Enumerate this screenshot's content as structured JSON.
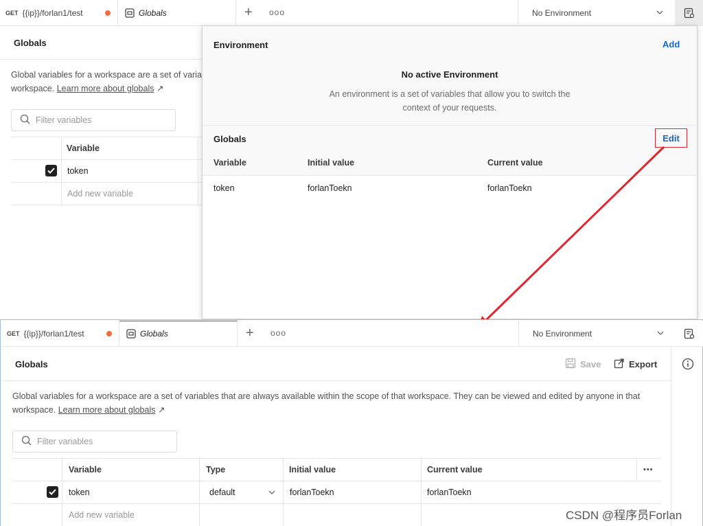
{
  "top": {
    "tab_request": {
      "method": "GET",
      "url": "{{ip}}/forlan1/test"
    },
    "tab_globals": "Globals",
    "environment_selector": "No Environment",
    "page_title": "Globals",
    "description_line1": "Global variables for a workspace are a set of varia",
    "description_line2_prefix": "workspace.",
    "learn_more": "Learn more about globals",
    "filter_placeholder": "Filter variables",
    "col_variable": "Variable",
    "row_variable": "token",
    "add_new": "Add new variable"
  },
  "popup": {
    "env_heading": "Environment",
    "add": "Add",
    "no_env_title": "No active Environment",
    "no_env_text_1": "An environment is a set of variables that allow you to switch the",
    "no_env_text_2": "context of your requests.",
    "globals_heading": "Globals",
    "edit": "Edit",
    "columns": [
      "Variable",
      "Initial value",
      "Current value"
    ],
    "row": [
      "token",
      "forlanToekn",
      "forlanToekn"
    ]
  },
  "bottom": {
    "tab_request": {
      "method": "GET",
      "url": "{{ip}}/forlan1/test"
    },
    "tab_globals": "Globals",
    "environment_selector": "No Environment",
    "page_title": "Globals",
    "save": "Save",
    "export": "Export",
    "description_line1": "Global variables for a workspace are a set of variables that are always available within the scope of that workspace. They can be viewed and edited by anyone in that",
    "description_line2_prefix": "workspace.",
    "learn_more": "Learn more about globals",
    "filter_placeholder": "Filter variables",
    "columns": [
      "Variable",
      "Type",
      "Initial value",
      "Current value"
    ],
    "row": {
      "variable": "token",
      "type": "default",
      "initial": "forlanToekn",
      "current": "forlanToekn"
    },
    "add_new": "Add new variable"
  },
  "watermark": "CSDN @程序员Forlan",
  "colors": {
    "annotation": "#e0262e",
    "link": "#1b64c8",
    "unsaved_dot": "#f26b3a"
  }
}
